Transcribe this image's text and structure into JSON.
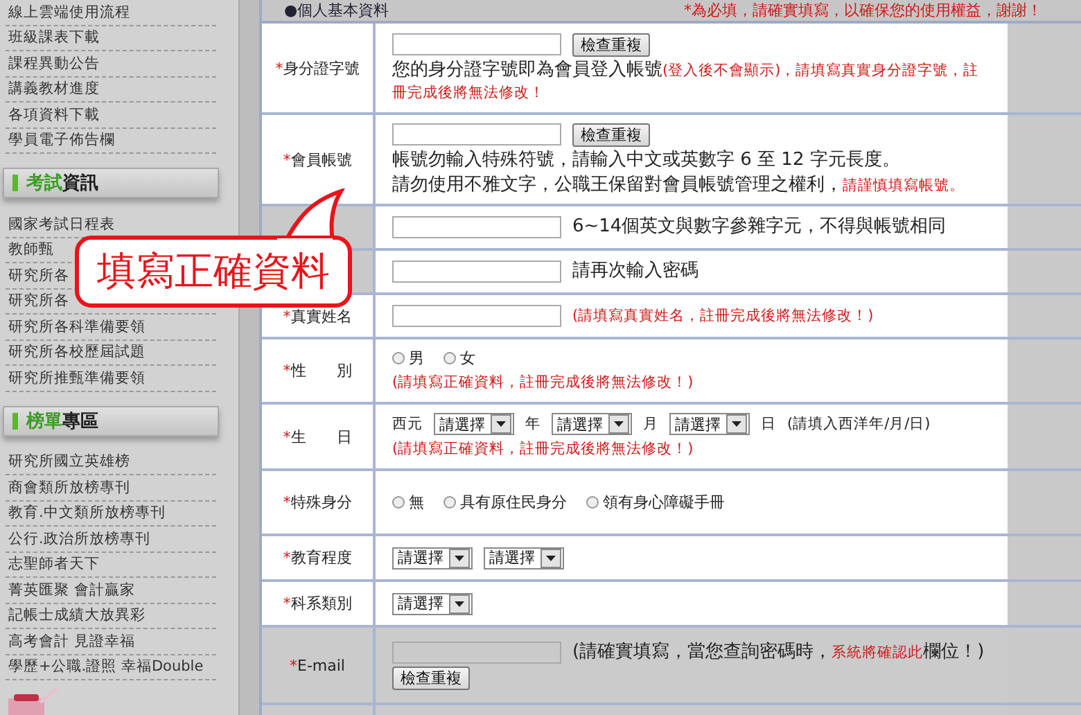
{
  "sidebar": {
    "groups": [
      {
        "items": [
          "線上雲端使用流程",
          "班級課表下載",
          "課程異動公告",
          "講義教材進度",
          "各項資料下載",
          "學員電子佈告欄"
        ]
      },
      {
        "header": {
          "accent": "考試",
          "rest": "資訊"
        },
        "items": [
          "國家考試日程表",
          "教師甄",
          "研究所各",
          "研究所各",
          "研究所各科準備要領",
          "研究所各校歷屆試題",
          "研究所推甄準備要領"
        ]
      },
      {
        "header": {
          "accent": "榜單",
          "rest": "專區"
        },
        "items": [
          "研究所國立英雄榜",
          "商會類所放榜專刊",
          "教育.中文類所放榜專刊",
          "公行.政治所放榜專刊",
          "志聖師者天下",
          "菁英匯聚 會計贏家",
          "記帳士成績大放異彩",
          "高考會計 見證幸福",
          "學歷+公職.證照 幸福Double"
        ]
      }
    ]
  },
  "form": {
    "section_title": "●個人基本資料",
    "required_notice": "*為必填，請確實填寫，以確保您的使用權益，謝謝！",
    "rows": [
      {
        "kind": "text_check",
        "highlighted": true,
        "label": {
          "mark": "*",
          "text": "身分證字號"
        },
        "button": "檢查重複",
        "note": [
          [
            {
              "kind": "normal",
              "text": "您的身分證字號即為會員登入帳號"
            },
            {
              "kind": "warning",
              "text": "(登入後不會顯示)，請填寫真實身分證字號，註冊完成後將無法修改！"
            }
          ]
        ]
      },
      {
        "kind": "text_check",
        "highlighted": true,
        "label": {
          "mark": "*",
          "text": "會員帳號"
        },
        "button": "檢查重複",
        "note": [
          [
            {
              "kind": "normal",
              "text": "帳號勿輸入特殊符號，請輸入中文或英數字 6 至 12 字元長度。"
            }
          ],
          [
            {
              "kind": "normal",
              "text": "請勿使用不雅文字，公職王保留對會員帳號管理之權利，"
            },
            {
              "kind": "warning",
              "text": "請謹慎填寫帳號。"
            }
          ]
        ]
      },
      {
        "kind": "text_note",
        "highlighted": true,
        "note": [
          [
            {
              "kind": "normal",
              "text": "6~14個英文與數字參雜字元，不得與帳號相同"
            }
          ]
        ]
      },
      {
        "kind": "text_note",
        "highlighted": true,
        "note": [
          [
            {
              "kind": "normal",
              "text": "請再次輸入密碼"
            }
          ]
        ]
      },
      {
        "kind": "text_note",
        "highlighted": true,
        "label": {
          "mark": "*",
          "text": "真實姓名"
        },
        "note": [
          [
            {
              "kind": "warning",
              "text": "(請填寫真實姓名，註冊完成後將無法修改！)"
            }
          ]
        ]
      },
      {
        "kind": "radio",
        "highlighted": true,
        "label": {
          "mark": "*",
          "text": "性　　別"
        },
        "options": [
          {
            "label": "男",
            "selected": false
          },
          {
            "label": "女",
            "selected": false
          }
        ],
        "note": [
          [
            {
              "kind": "warning",
              "text": "(請填寫正確資料，註冊完成後將無法修改！)"
            }
          ]
        ]
      },
      {
        "kind": "date",
        "highlighted": true,
        "label": {
          "mark": "*",
          "text": "生　　日"
        },
        "prefix": "西元",
        "selects": [
          {
            "value": "請選擇",
            "unit": "年"
          },
          {
            "value": "請選擇",
            "unit": "月"
          },
          {
            "value": "請選擇",
            "unit": "日"
          }
        ],
        "hint": "(請填入西洋年/月/日)",
        "note": [
          [
            {
              "kind": "warning",
              "text": "(請填寫正確資料，註冊完成後將無法修改！)"
            }
          ]
        ]
      },
      {
        "kind": "radio",
        "highlighted": true,
        "label": {
          "mark": "*",
          "text": "特殊身分"
        },
        "options": [
          {
            "label": "無",
            "selected": false
          },
          {
            "label": "具有原住民身分",
            "selected": false
          },
          {
            "label": "領有身心障礙手冊",
            "selected": false
          }
        ]
      },
      {
        "kind": "selects",
        "highlighted": true,
        "label": {
          "mark": "*",
          "text": "教育程度"
        },
        "selects": [
          {
            "value": "請選擇"
          },
          {
            "value": "請選擇"
          }
        ]
      },
      {
        "kind": "selects",
        "highlighted": true,
        "label": {
          "mark": "*",
          "text": "科系類別"
        },
        "selects": [
          {
            "value": "請選擇"
          }
        ]
      },
      {
        "kind": "email",
        "highlighted": false,
        "label": {
          "mark": "*",
          "text": "E-mail"
        },
        "button": "檢查重複",
        "note": [
          [
            {
              "kind": "normal",
              "text": "(請確實填寫，當您查詢密碼時，"
            },
            {
              "kind": "warning",
              "text": "系統將確認此"
            },
            {
              "kind": "normal",
              "text": "欄位！)"
            }
          ]
        ]
      },
      {
        "kind": "blank",
        "highlighted": false
      }
    ]
  },
  "callout": {
    "text": "填寫正確資料"
  }
}
